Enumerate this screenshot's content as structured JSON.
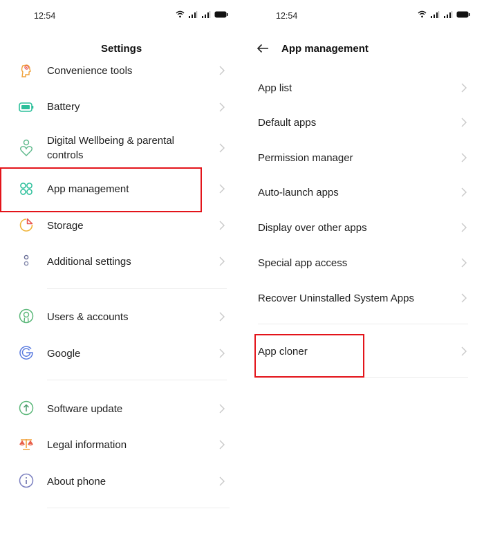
{
  "status_bar": {
    "time": "12:54",
    "icons": [
      "wifi-icon",
      "signal-icon",
      "signal-icon",
      "battery-icon"
    ]
  },
  "left_screen": {
    "title": "Settings",
    "items": [
      {
        "label": "Convenience tools",
        "icon": "convenience-tools-icon",
        "icon_color": "#f0a23a"
      },
      {
        "label": "Battery",
        "icon": "battery-icon",
        "icon_color": "#2bbf9a"
      },
      {
        "label": "Digital Wellbeing & parental controls",
        "label_line1": "Digital Wellbeing & parental",
        "label_line2": "controls",
        "icon": "wellbeing-icon",
        "icon_color": "#5cb88a"
      },
      {
        "label": "App management",
        "icon": "app-management-icon",
        "icon_color": "#2bbf9a",
        "highlighted": true
      },
      {
        "label": "Storage",
        "icon": "storage-icon",
        "icon_color": "#f0b43a"
      },
      {
        "label": "Additional settings",
        "icon": "additional-settings-icon",
        "icon_color": "#7a7fa8"
      },
      {
        "label": "Users & accounts",
        "icon": "users-accounts-icon",
        "icon_color": "#5cb87a"
      },
      {
        "label": "Google",
        "icon": "google-icon",
        "icon_color": "#5b7ce0"
      },
      {
        "label": "Software update",
        "icon": "software-update-icon",
        "icon_color": "#5cb87a"
      },
      {
        "label": "Legal information",
        "icon": "legal-information-icon",
        "icon_color": "#f07a3a"
      },
      {
        "label": "About phone",
        "icon": "about-phone-icon",
        "icon_color": "#7a7fc0"
      }
    ]
  },
  "right_screen": {
    "title": "App management",
    "back_icon": "back-arrow-icon",
    "items": [
      {
        "label": "App list"
      },
      {
        "label": "Default apps"
      },
      {
        "label": "Permission manager"
      },
      {
        "label": "Auto-launch apps"
      },
      {
        "label": "Display over other apps"
      },
      {
        "label": "Special app access"
      },
      {
        "label": "Recover Uninstalled System Apps"
      },
      {
        "label": "App cloner",
        "highlighted": true
      }
    ]
  },
  "colors": {
    "highlight_border": "#e3141a",
    "chevron": "#c8c8c8",
    "divider": "#ececec"
  }
}
